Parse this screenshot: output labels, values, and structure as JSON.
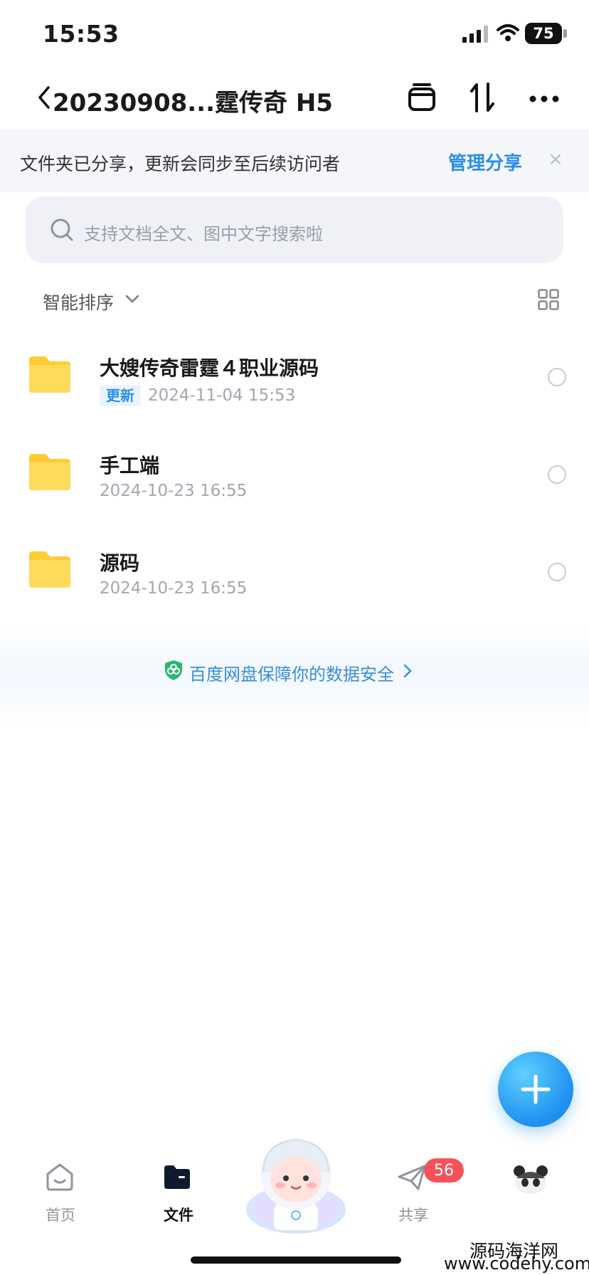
{
  "status_bar": {
    "time": "15:53",
    "battery": "75"
  },
  "nav": {
    "title": "20230908...霆传奇 H5"
  },
  "banner": {
    "text": "文件夹已分享，更新会同步至后续访问者",
    "link": "管理分享",
    "close": "×"
  },
  "search": {
    "placeholder": "支持文档全文、图中文字搜索啦"
  },
  "sort": {
    "label": "智能排序"
  },
  "files": [
    {
      "name": "大嫂传奇雷霆４职业源码",
      "tag": "更新",
      "date": "2024-11-04 15:53"
    },
    {
      "name": "手工端",
      "tag": "",
      "date": "2024-10-23 16:55"
    },
    {
      "name": "源码",
      "tag": "",
      "date": "2024-10-23 16:55"
    }
  ],
  "safety": {
    "text": "百度网盘保障你的数据安全"
  },
  "tabbar": {
    "home": "首页",
    "files": "文件",
    "share": "共享",
    "share_badge": "56"
  },
  "watermark": {
    "line1": "源码海洋网",
    "line2": "www.codehy.com"
  },
  "colors": {
    "accent": "#2b8fe8",
    "folder": "#ffd04a",
    "badge": "#f4525a"
  }
}
